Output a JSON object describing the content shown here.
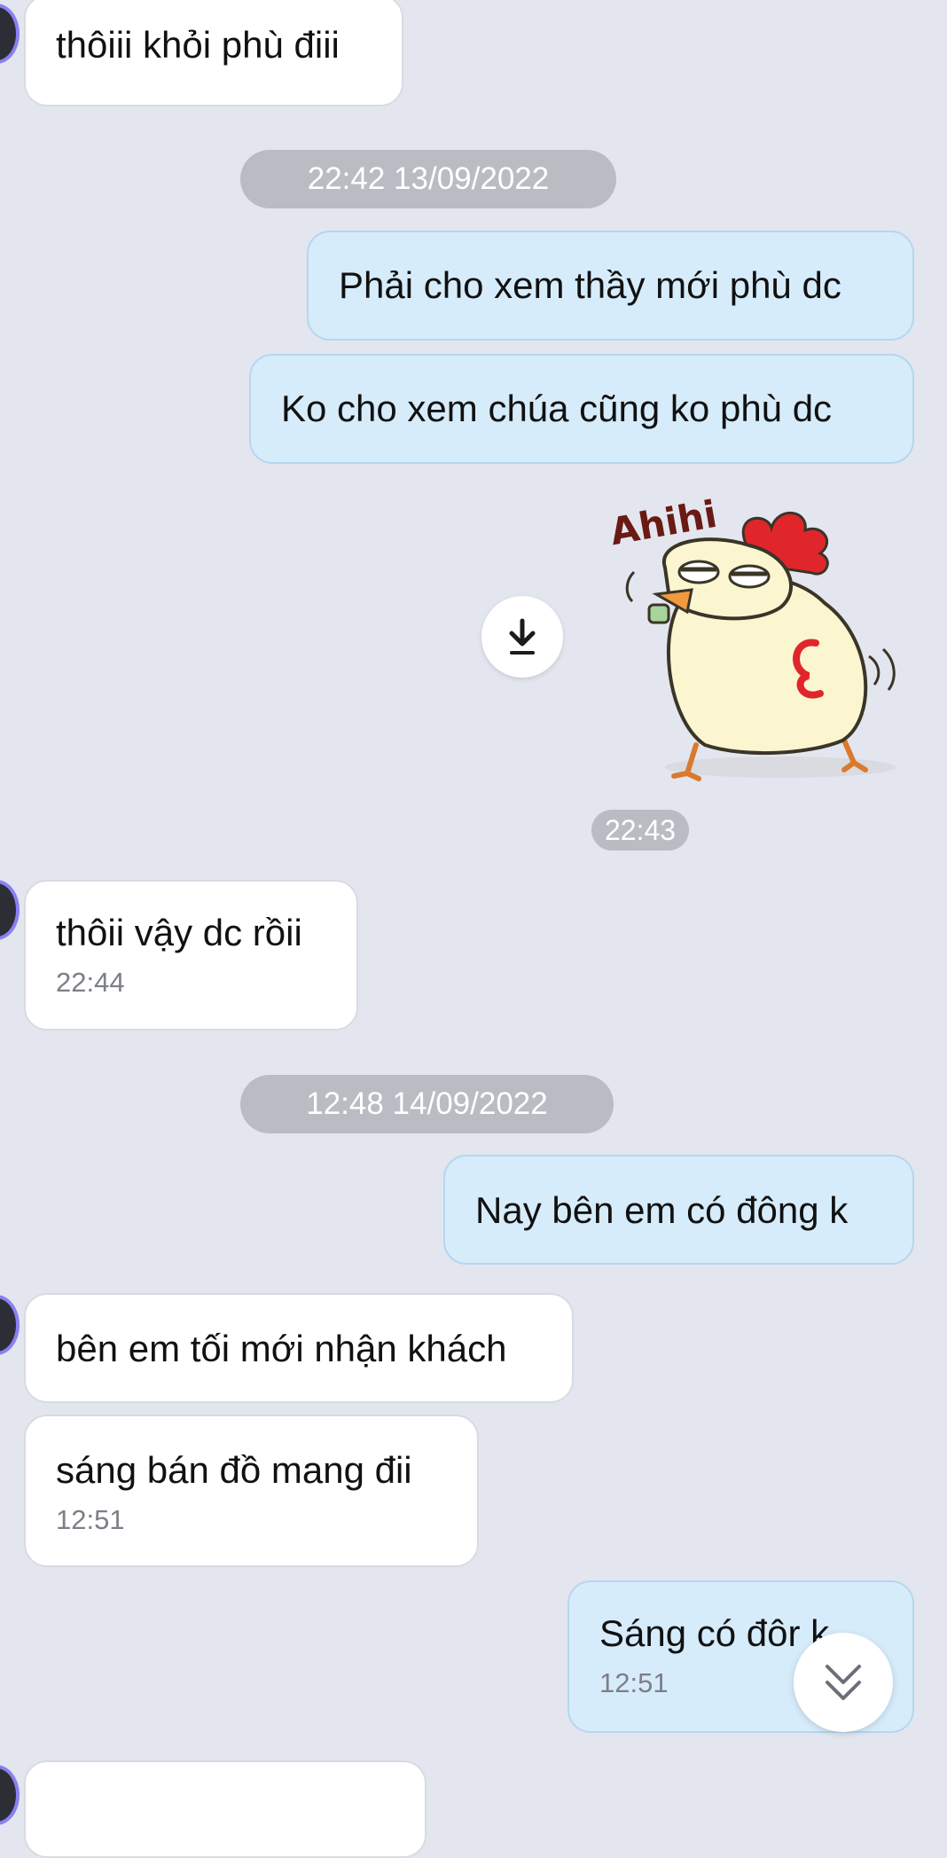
{
  "messages": [
    {
      "id": "m1",
      "side": "in",
      "text": "thôiii khỏi phù điii"
    },
    {
      "id": "d1",
      "type": "date",
      "text": "22:42 13/09/2022"
    },
    {
      "id": "m2",
      "side": "out",
      "text": "Phải cho xem thầy mới phù dc"
    },
    {
      "id": "m3",
      "side": "out",
      "text": "Ko cho xem chúa cũng ko phù dc"
    },
    {
      "id": "s1",
      "type": "sticker",
      "sticker_text": "Ahihi",
      "time": "22:43"
    },
    {
      "id": "m4",
      "side": "in",
      "text": "thôii vậy dc rồii",
      "time": "22:44"
    },
    {
      "id": "d2",
      "type": "date",
      "text": "12:48 14/09/2022"
    },
    {
      "id": "m5",
      "side": "out",
      "text": "Nay bên em có đông k"
    },
    {
      "id": "m6",
      "side": "in",
      "text": "bên em tối mới nhận khách"
    },
    {
      "id": "m7",
      "side": "in",
      "text": "sáng bán đồ mang đii",
      "time": "12:51"
    },
    {
      "id": "m8",
      "side": "out",
      "text": "Sáng có đôr   k",
      "time": "12:51"
    }
  ],
  "icons": {
    "download": "download-icon",
    "scroll_down": "double-chevron-down-icon"
  },
  "colors": {
    "background": "#e3e6ef",
    "incoming_bubble": "#ffffff",
    "outgoing_bubble": "#d6ecfb",
    "pill": "#b9bcc3",
    "sticker_body": "#fbf6cf",
    "sticker_comb": "#e0262b"
  }
}
